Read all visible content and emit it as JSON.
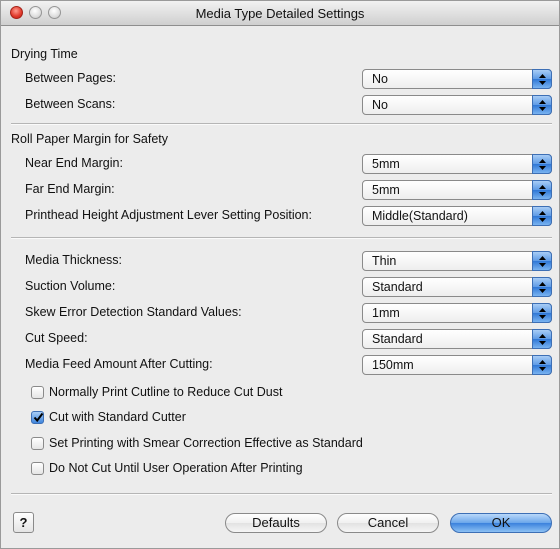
{
  "window": {
    "title": "Media Type Detailed Settings"
  },
  "drying": {
    "heading": "Drying Time",
    "between_pages": {
      "label": "Between Pages:",
      "value": "No"
    },
    "between_scans": {
      "label": "Between Scans:",
      "value": "No"
    }
  },
  "roll": {
    "heading": "Roll Paper Margin for Safety",
    "near_end": {
      "label": "Near End Margin:",
      "value": "5mm"
    },
    "far_end": {
      "label": "Far End Margin:",
      "value": "5mm"
    },
    "printhead": {
      "label": "Printhead Height Adjustment Lever Setting Position:",
      "value": "Middle(Standard)"
    }
  },
  "media": {
    "thickness": {
      "label": "Media Thickness:",
      "value": "Thin"
    },
    "suction": {
      "label": "Suction Volume:",
      "value": "Standard"
    },
    "skew": {
      "label": "Skew Error Detection Standard Values:",
      "value": "1mm"
    },
    "cut_speed": {
      "label": "Cut Speed:",
      "value": "Standard"
    },
    "feed_after_cut": {
      "label": "Media Feed Amount After Cutting:",
      "value": "150mm"
    }
  },
  "checkboxes": [
    {
      "label": "Normally Print Cutline to Reduce Cut Dust",
      "checked": false
    },
    {
      "label": "Cut with Standard Cutter",
      "checked": true
    },
    {
      "label": "Set Printing with Smear Correction Effective as Standard",
      "checked": false
    },
    {
      "label": "Do Not Cut Until User Operation After Printing",
      "checked": false
    }
  ],
  "footer": {
    "help": "?",
    "defaults": "Defaults",
    "cancel": "Cancel",
    "ok": "OK"
  },
  "colors": {
    "accent": "#3f85dd",
    "window_bg": "#ececec"
  }
}
